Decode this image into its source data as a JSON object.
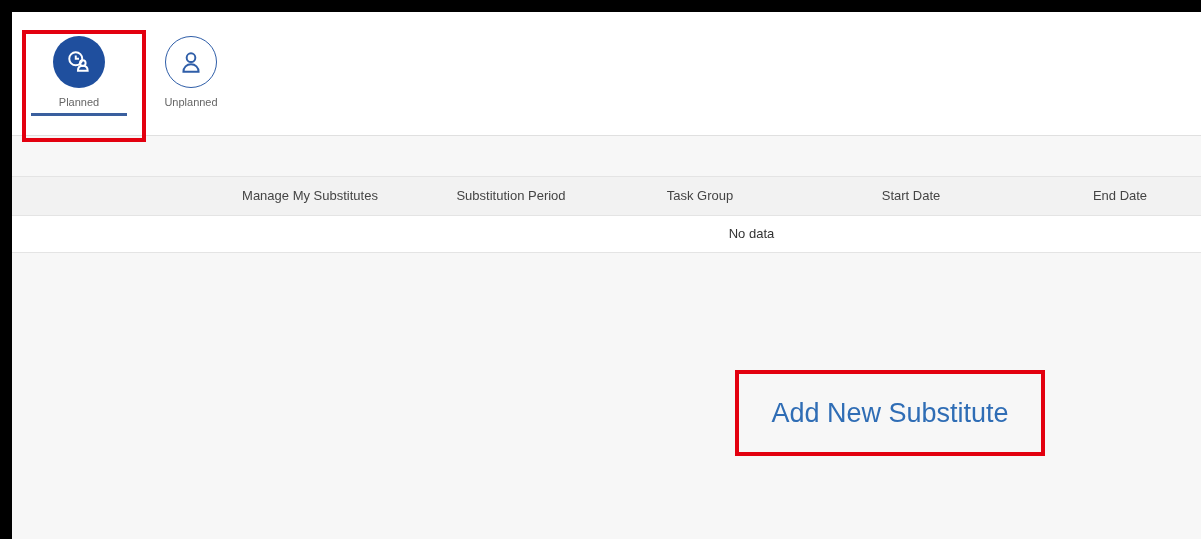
{
  "tabs": [
    {
      "label": "Planned",
      "kind": "scheduled",
      "selected": true,
      "highlighted": true
    },
    {
      "label": "Unplanned",
      "kind": "adhoc",
      "selected": false,
      "highlighted": false
    }
  ],
  "table": {
    "columns": [
      "Manage My Substitutes",
      "Substitution Period",
      "Task Group",
      "Start Date",
      "End Date"
    ],
    "empty_text": "No data"
  },
  "add_link": {
    "label": "Add New Substitute",
    "highlighted": true
  }
}
